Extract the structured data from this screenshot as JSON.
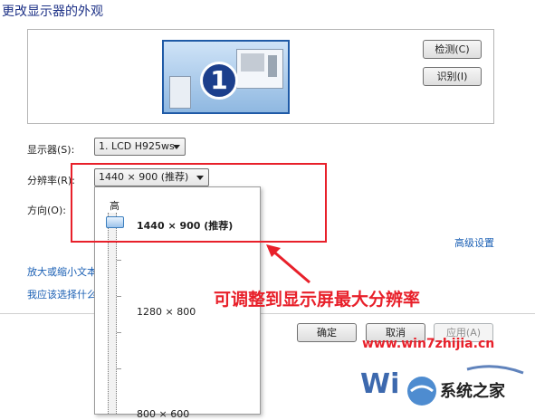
{
  "window": {
    "title": "更改显示器的外观"
  },
  "preview": {
    "monitor_number": "1"
  },
  "buttons": {
    "detect": "检测(C)",
    "identify": "识别(I)",
    "ok": "确定",
    "cancel": "取消",
    "apply": "应用(A)"
  },
  "form": {
    "display_label": "显示器(S):",
    "display_value": "1. LCD H925ws",
    "resolution_label": "分辨率(R):",
    "resolution_value": "1440 × 900 (推荐)",
    "orientation_label": "方向(O):"
  },
  "links": {
    "advanced": "高级设置",
    "text_size": "放大或缩小文本",
    "which_settings": "我应该选择什么"
  },
  "resolution_popup": {
    "high_label": "高",
    "items": [
      {
        "label": "1440 × 900 (推荐)",
        "selected": true
      },
      {
        "label": "1280 × 800"
      },
      {
        "label": "800 × 600"
      }
    ],
    "slider_position": "1440 × 900 (推荐)"
  },
  "annotation": {
    "text": "可调整到显示屏最大分辨率",
    "color": "#e8202a"
  },
  "watermark": {
    "url": "www.win7zhijia.cn",
    "brand": "系统之家",
    "logo_text": "Win"
  }
}
